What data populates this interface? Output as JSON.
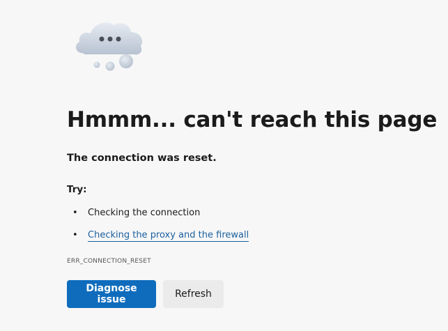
{
  "illustration": {
    "icon": "cloud-thinking-icon"
  },
  "error": {
    "title": "Hmmm... can't reach this page",
    "subtitle": "The connection was reset.",
    "try_label": "Try:",
    "suggestions": [
      {
        "label": "Checking the connection",
        "is_link": false
      },
      {
        "label": "Checking the proxy and the firewall",
        "is_link": true
      }
    ],
    "code": "ERR_CONNECTION_RESET"
  },
  "buttons": {
    "diagnose_label": "Diagnose issue",
    "refresh_label": "Refresh"
  },
  "colors": {
    "accent": "#0f6cbd",
    "link": "#1a5f9e",
    "background": "#f7f7f7"
  }
}
